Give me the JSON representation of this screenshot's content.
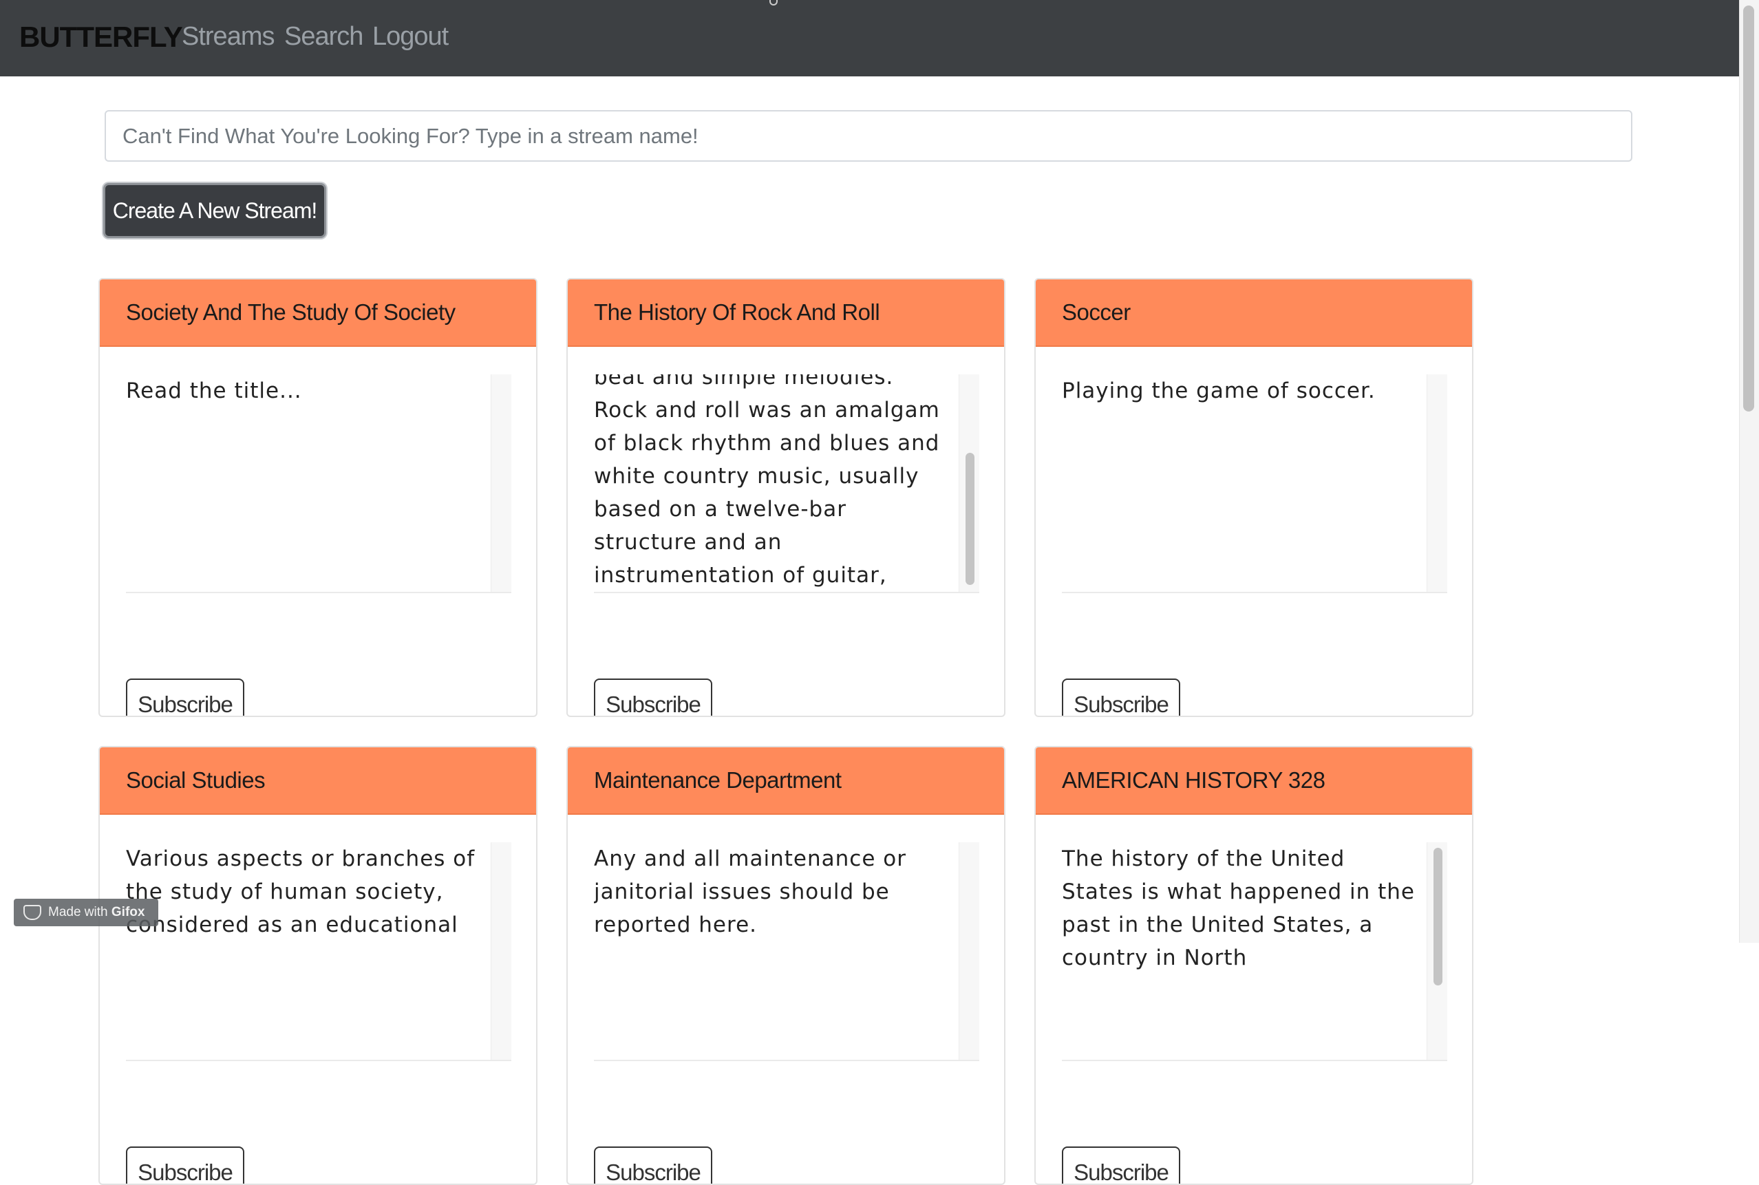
{
  "navbar": {
    "brand": "BUTTERFLY",
    "links": [
      "Streams",
      "Search",
      "Logout"
    ]
  },
  "search": {
    "placeholder": "Can't Find What You're Looking For? Type in a stream name!"
  },
  "create_button": "Create A New Stream!",
  "cards": [
    {
      "title": "Society And The Study Of Society",
      "description": "Read the title...",
      "subscribe": "Subscribe"
    },
    {
      "title": "The History Of Rock And Roll",
      "description": "beat and simple melodies. Rock and roll was an amalgam of black rhythm and blues and white country music, usually based on a twelve-bar structure and an instrumentation of guitar, bass, and drums.",
      "subscribe": "Subscribe"
    },
    {
      "title": "Soccer",
      "description": "Playing the game of soccer.",
      "subscribe": "Subscribe"
    },
    {
      "title": "Social Studies",
      "description": "Various aspects or branches of the study of human society, considered as an educational",
      "subscribe": "Subscribe"
    },
    {
      "title": "Maintenance Department",
      "description": "Any and all maintenance or janitorial issues should be reported here.",
      "subscribe": "Subscribe"
    },
    {
      "title": "AMERICAN HISTORY 328",
      "description": "The history of the United States is what happened in the past in the United States, a country in North",
      "subscribe": "Subscribe"
    }
  ],
  "watermark": {
    "prefix": "Made with",
    "brand": "Gifox"
  },
  "colors": {
    "navbar": "#3d4043",
    "card_header": "#ff8a5a",
    "create_button": "#3a3d41"
  }
}
